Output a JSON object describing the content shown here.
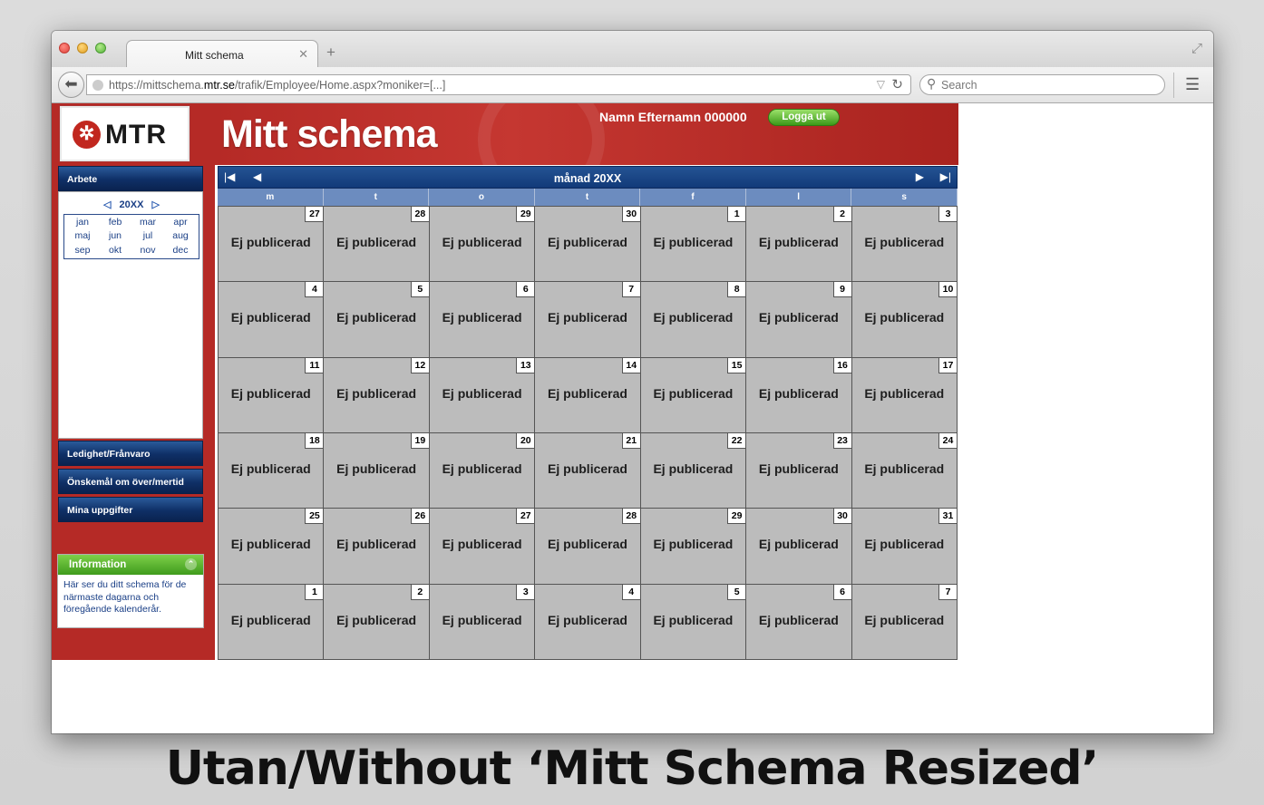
{
  "browser": {
    "tab_title": "Mitt schema",
    "url_prefix": "https://mittschema.",
    "url_domain": "mtr.se",
    "url_suffix": "/trafik/Employee/Home.aspx?moniker=[...]",
    "search_placeholder": "Search"
  },
  "header": {
    "logo_text": "MTR",
    "title": "Mitt schema",
    "user_name": "Namn Efternamn 000000",
    "logout_label": "Logga ut"
  },
  "sidebar": {
    "work_label": "Arbete",
    "year": "20XX",
    "months": [
      "jan",
      "feb",
      "mar",
      "apr",
      "maj",
      "jun",
      "jul",
      "aug",
      "sep",
      "okt",
      "nov",
      "dec"
    ],
    "menu_items": [
      "Ledighet/Frånvaro",
      "Önskemål om över/mertid",
      "Mina uppgifter"
    ],
    "info_title": "Information",
    "info_text": "Här ser du ditt schema för de närmaste dagarna och föregående kalenderår."
  },
  "calendar": {
    "title": "månad 20XX",
    "weekdays": [
      "m",
      "t",
      "o",
      "t",
      "f",
      "l",
      "s"
    ],
    "cell_label": "Ej publicerad",
    "days": [
      27,
      28,
      29,
      30,
      1,
      2,
      3,
      4,
      5,
      6,
      7,
      8,
      9,
      10,
      11,
      12,
      13,
      14,
      15,
      16,
      17,
      18,
      19,
      20,
      21,
      22,
      23,
      24,
      25,
      26,
      27,
      28,
      29,
      30,
      31,
      1,
      2,
      3,
      4,
      5,
      6,
      7
    ]
  },
  "caption": "Utan/Without ‘Mitt Schema Resized’"
}
